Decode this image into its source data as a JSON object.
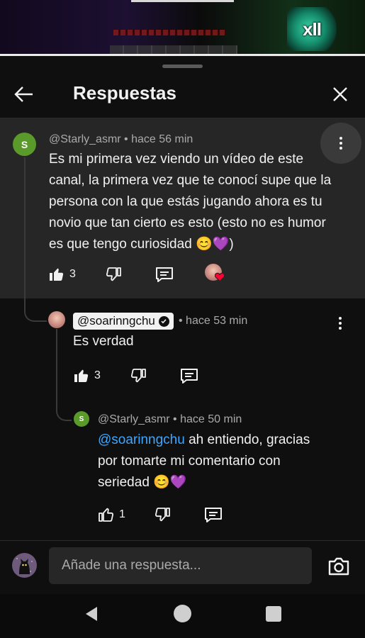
{
  "video": {
    "badge_text": "xII"
  },
  "header": {
    "title": "Respuestas"
  },
  "parent_comment": {
    "author": "@Starly_asmr",
    "time": "hace 56 min",
    "avatar_letter": "S",
    "avatar_color": "#5a9a2a",
    "text": "Es mi primera vez viendo un vídeo de este canal, la primera vez que te conocí supe que la persona con la que estás jugando ahora es tu novio que tan cierto es esto (esto no es humor es que tengo curiosidad 😊💜)",
    "likes": "3",
    "liked": true
  },
  "reply_1": {
    "author": "@soarinngchu",
    "time": "hace 53 min",
    "text": "Es verdad",
    "likes": "3",
    "liked": true
  },
  "reply_2": {
    "author": "@Starly_asmr",
    "time": "hace 50 min",
    "avatar_letter": "S",
    "mention": "@soarinngchu",
    "text": " ah entiendo, gracias por tomarte mi comentario con seriedad 😊💜",
    "likes": "1",
    "liked": false
  },
  "composer": {
    "placeholder": "Añade una respuesta..."
  },
  "colors": {
    "background": "#0f0f0f",
    "highlight": "#262626",
    "mention": "#3ea6ff",
    "heart": "#ff0033"
  }
}
